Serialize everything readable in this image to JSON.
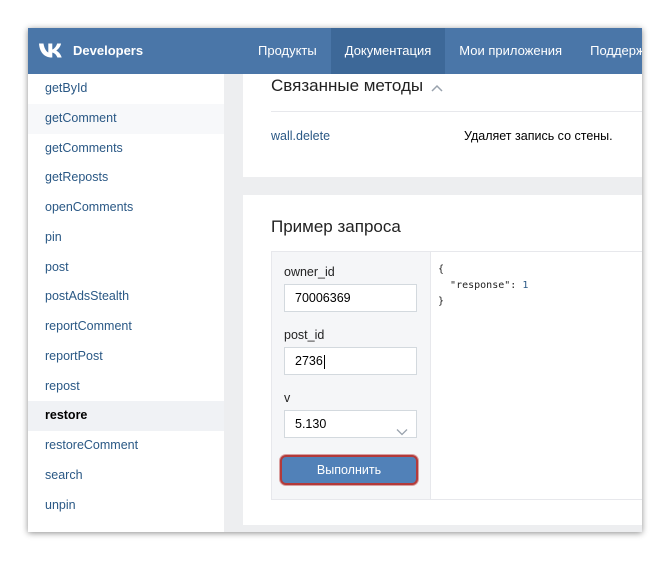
{
  "header": {
    "brand": "Developers",
    "nav": [
      {
        "label": "Продукты"
      },
      {
        "label": "Документация"
      },
      {
        "label": "Мои приложения"
      },
      {
        "label": "Поддержка"
      }
    ],
    "active_nav": "Документация",
    "colors": {
      "bar": "#4a76a8",
      "active": "#3d6898"
    }
  },
  "sidebar": {
    "items": [
      {
        "label": "getById"
      },
      {
        "label": "getComment"
      },
      {
        "label": "getComments"
      },
      {
        "label": "getReposts"
      },
      {
        "label": "openComments"
      },
      {
        "label": "pin"
      },
      {
        "label": "post"
      },
      {
        "label": "postAdsStealth"
      },
      {
        "label": "reportComment"
      },
      {
        "label": "reportPost"
      },
      {
        "label": "repost"
      },
      {
        "label": "restore"
      },
      {
        "label": "restoreComment"
      },
      {
        "label": "search"
      },
      {
        "label": "unpin"
      }
    ],
    "active": "restore"
  },
  "related": {
    "title": "Связанные методы",
    "method": "wall.delete",
    "description": "Удаляет запись со стены."
  },
  "example": {
    "title": "Пример запроса",
    "fields": {
      "owner_id": {
        "label": "owner_id",
        "value": "70006369"
      },
      "post_id": {
        "label": "post_id",
        "value": "2736"
      },
      "v": {
        "label": "v",
        "value": "5.130"
      }
    },
    "run_label": "Выполнить",
    "response": {
      "open": "{",
      "key": "\"response\"",
      "sep": ": ",
      "value": "1",
      "close": "}"
    }
  }
}
